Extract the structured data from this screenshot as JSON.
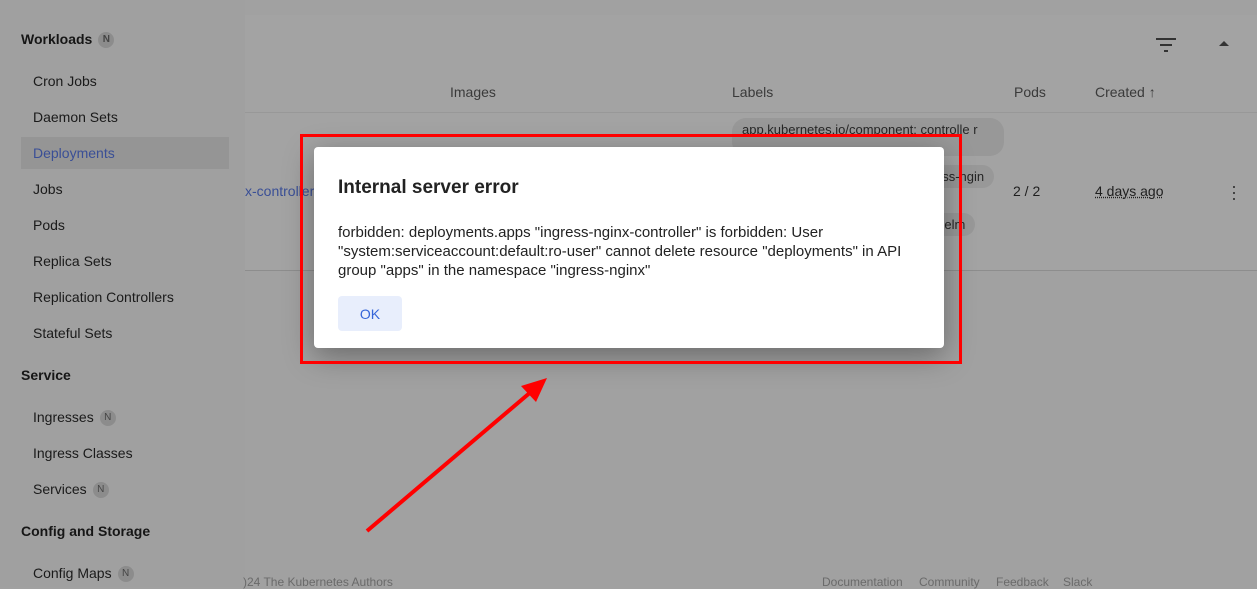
{
  "sidebar": {
    "sections": [
      {
        "label": "Workloads",
        "badge": "N"
      },
      {
        "label": "Service"
      },
      {
        "label": "Config and Storage"
      }
    ],
    "workloads": [
      {
        "label": "Cron Jobs"
      },
      {
        "label": "Daemon Sets"
      },
      {
        "label": "Deployments",
        "active": true
      },
      {
        "label": "Jobs"
      },
      {
        "label": "Pods"
      },
      {
        "label": "Replica Sets"
      },
      {
        "label": "Replication Controllers"
      },
      {
        "label": "Stateful Sets"
      }
    ],
    "service": [
      {
        "label": "Ingresses",
        "badge": "N"
      },
      {
        "label": "Ingress Classes"
      },
      {
        "label": "Services",
        "badge": "N"
      }
    ],
    "config": [
      {
        "label": "Config Maps",
        "badge": "N"
      }
    ]
  },
  "table": {
    "columns": {
      "images": "Images",
      "labels": "Labels",
      "pods": "Pods",
      "created": "Created"
    },
    "row": {
      "name": "x-controller",
      "labels": [
        "app.kubernetes.io/component: controlle r",
        "ess-ngin",
        "Helm"
      ],
      "pods": "2 / 2",
      "created": "4 days ago"
    }
  },
  "footer": {
    "copyright": ")24 The Kubernetes Authors",
    "links": [
      "Documentation",
      "Community",
      "Feedback",
      "Slack"
    ]
  },
  "dialog": {
    "title": "Internal server error",
    "message": "forbidden: deployments.apps \"ingress-nginx-controller\" is forbidden: User \"system:serviceaccount:default:ro-user\" cannot delete resource \"deployments\" in API group \"apps\" in the namespace \"ingress-nginx\"",
    "ok_label": "OK"
  },
  "annotation": {
    "color": "#ff0000"
  }
}
